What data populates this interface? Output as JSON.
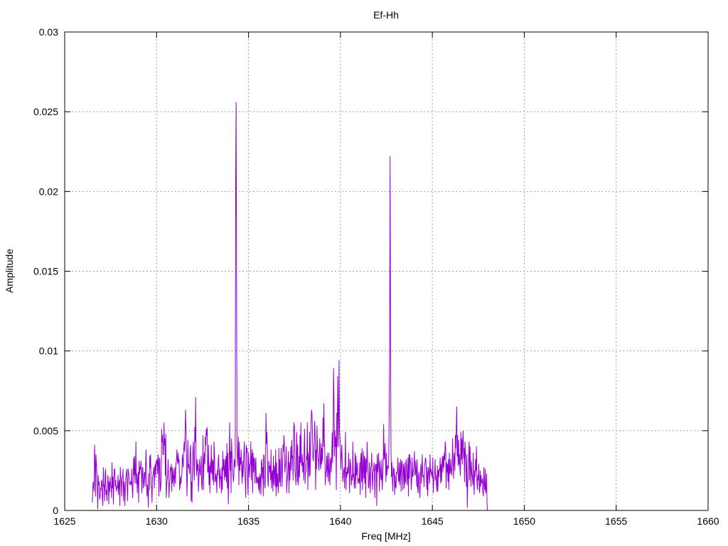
{
  "chart_data": {
    "type": "line",
    "title": "Ef-Hh",
    "xlabel": "Freq [MHz]",
    "ylabel": "Amplitude",
    "xlim": [
      1625,
      1660
    ],
    "ylim": [
      0,
      0.03
    ],
    "x_ticks": [
      "1625",
      "1630",
      "1635",
      "1640",
      "1645",
      "1650",
      "1655",
      "1660"
    ],
    "y_ticks": [
      "0",
      "0.005",
      "0.01",
      "0.015",
      "0.02",
      "0.025",
      "0.03"
    ],
    "grid": true,
    "legend": "none",
    "series": [
      {
        "color": "#9400d3",
        "x_start": 1626.5,
        "x_step": 0.025,
        "values": [
          0.0005,
          0.0012,
          0.0018,
          0.0015,
          0.0012,
          0.0041,
          0.0032,
          0.0009,
          0.0035,
          0.003,
          0.0023,
          0.0012,
          0.0001,
          0.0022,
          0.0016,
          0.0018,
          0.0007,
          0.0008,
          0.0014,
          0.0013,
          0.0019,
          0.0018,
          0.0007,
          0.0003,
          0.0027,
          0.0015,
          0.0016,
          0.0006,
          0.0023,
          0.0026,
          0.001,
          0.0013,
          0.0006,
          0.0013,
          0.0022,
          0.0017,
          0.0004,
          0.0018,
          0.0012,
          0.0021,
          0.0015,
          0.0015,
          0.0008,
          0.003,
          0.0014,
          0.0021,
          0.0004,
          0.0019,
          0.0026,
          0.0026,
          0.0015,
          0.0019,
          0.0014,
          0.0012,
          0.0015,
          0.0014,
          0.0022,
          0.001,
          0.0017,
          0.0019,
          0.0003,
          0.0027,
          0.0021,
          0.0018,
          0.0009,
          0.0021,
          0.0021,
          0.0026,
          0.0006,
          0.0018,
          0.0016,
          0.0003,
          0.0015,
          0.0021,
          0.0023,
          0.0026,
          0.0014,
          0.0006,
          0.0026,
          0.0024,
          0.0022,
          0.0017,
          0.0016,
          0.0018,
          0.0018,
          0.0016,
          0.0026,
          0.0013,
          0.0008,
          0.0021,
          0.0033,
          0.0022,
          0.0034,
          0.0017,
          0.0024,
          0.0043,
          0.0017,
          0.0023,
          0.0011,
          0.0019,
          0.0024,
          0.0005,
          0.0031,
          0.0023,
          0.0027,
          0.0026,
          0.0031,
          0.0024,
          0.0011,
          0.0026,
          0.0027,
          0.0014,
          0.0017,
          0.0023,
          0.0024,
          0.0015,
          0.0029,
          0.0038,
          0.0022,
          0.0009,
          0.0016,
          0.0011,
          0.0002,
          0.0023,
          0.0013,
          0.0034,
          0.0027,
          0.0035,
          0.0015,
          0.0015,
          0.0005,
          0.002,
          0.0023,
          0.0024,
          0.0027,
          0.0014,
          0.0027,
          0.0029,
          0.0021,
          0.0031,
          0.0029,
          0.0032,
          0.0023,
          0.0035,
          0.0031,
          0.0009,
          0.0033,
          0.0032,
          0.0012,
          0.0014,
          0.002,
          0.0051,
          0.0043,
          0.0047,
          0.0035,
          0.0035,
          0.0055,
          0.0041,
          0.0045,
          0.0022,
          0.0048,
          0.0008,
          0.0016,
          0.0019,
          0.0022,
          0.0032,
          0.0021,
          0.0008,
          0.0016,
          0.0019,
          0.0027,
          0.0025,
          0.0029,
          0.0012,
          0.0027,
          0.0017,
          0.0021,
          0.0026,
          0.0015,
          0.0021,
          0.0027,
          0.0017,
          0.0029,
          0.0031,
          0.0038,
          0.0032,
          0.0029,
          0.0036,
          0.003,
          0.0032,
          0.0013,
          0.0015,
          0.0021,
          0.0017,
          0.0021,
          0.0023,
          0.0035,
          0.0031,
          0.0027,
          0.0038,
          0.0043,
          0.0037,
          0.0049,
          0.0063,
          0.0051,
          0.0033,
          0.0009,
          0.0021,
          0.0044,
          0.0027,
          0.0029,
          0.0025,
          0.0023,
          0.0038,
          0.0041,
          0.0006,
          0.0018,
          0.0005,
          0.003,
          0.0038,
          0.0043,
          0.0024,
          0.0019,
          0.0052,
          0.0043,
          0.0071,
          0.003,
          0.0022,
          0.0032,
          0.0025,
          0.0029,
          0.0012,
          0.0019,
          0.0032,
          0.0025,
          0.0022,
          0.0028,
          0.0034,
          0.0016,
          0.0013,
          0.0026,
          0.0047,
          0.0013,
          0.0031,
          0.0036,
          0.0029,
          0.0046,
          0.0041,
          0.0051,
          0.0047,
          0.0052,
          0.0024,
          0.0024,
          0.0041,
          0.0016,
          0.0028,
          0.0011,
          0.003,
          0.0024,
          0.0041,
          0.0023,
          0.0032,
          0.0019,
          0.0031,
          0.0016,
          0.0043,
          0.0036,
          0.0018,
          0.0018,
          0.0023,
          0.0021,
          0.0011,
          0.0025,
          0.0022,
          0.0031,
          0.0035,
          0.0022,
          0.0014,
          0.0026,
          0.002,
          0.0021,
          0.0011,
          0.0027,
          0.0013,
          0.0037,
          0.0025,
          0.0032,
          0.0026,
          0.0019,
          0.0032,
          0.0021,
          0.0034,
          0.0018,
          0.0042,
          0.0014,
          0.0036,
          0.0004,
          0.0017,
          0.0035,
          0.0055,
          0.0025,
          0.0037,
          0.0011,
          0.0045,
          0.0036,
          0.0031,
          0.0024,
          0.0018,
          0.0021,
          0.0032,
          0.0029,
          0.0027,
          0.0205,
          0.0256,
          0.0145,
          0.0042,
          0.0028,
          0.0035,
          0.0046,
          0.0016,
          0.0043,
          0.0025,
          0.0033,
          0.0029,
          0.0038,
          0.0026,
          0.0017,
          0.0031,
          0.0021,
          0.0028,
          0.0037,
          0.0043,
          0.0024,
          0.0018,
          0.0008,
          0.0041,
          0.0036,
          0.0039,
          0.0019,
          0.001,
          0.0036,
          0.0028,
          0.0021,
          0.0029,
          0.0029,
          0.0043,
          0.0019,
          0.0033,
          0.0038,
          0.0011,
          0.0036,
          0.0024,
          0.0033,
          0.0032,
          0.0017,
          0.0028,
          0.0033,
          0.0017,
          0.0021,
          0.0019,
          0.0017,
          0.0021,
          0.0013,
          0.0021,
          0.0011,
          0.0023,
          0.0021,
          0.001,
          0.003,
          0.0032,
          0.002,
          0.0027,
          0.0009,
          0.0035,
          0.0034,
          0.0016,
          0.0014,
          0.0026,
          0.0061,
          0.0042,
          0.0049,
          0.0038,
          0.0019,
          0.0015,
          0.0031,
          0.0028,
          0.0024,
          0.0028,
          0.0019,
          0.0038,
          0.0014,
          0.0022,
          0.0025,
          0.0012,
          0.0034,
          0.0016,
          0.0028,
          0.0025,
          0.0015,
          0.0038,
          0.0009,
          0.003,
          0.0015,
          0.0023,
          0.0015,
          0.0011,
          0.0039,
          0.0018,
          0.0032,
          0.0015,
          0.002,
          0.0039,
          0.0028,
          0.0015,
          0.0027,
          0.0041,
          0.0037,
          0.0047,
          0.0042,
          0.0024,
          0.0029,
          0.0029,
          0.004,
          0.0011,
          0.0018,
          0.0021,
          0.0029,
          0.0037,
          0.0011,
          0.003,
          0.0019,
          0.0029,
          0.004,
          0.0025,
          0.0044,
          0.0033,
          0.0034,
          0.0019,
          0.0048,
          0.0055,
          0.0052,
          0.0024,
          0.0022,
          0.0016,
          0.0038,
          0.0049,
          0.0018,
          0.0041,
          0.0016,
          0.002,
          0.0034,
          0.0021,
          0.0047,
          0.003,
          0.0055,
          0.003,
          0.0028,
          0.0035,
          0.0024,
          0.003,
          0.0019,
          0.0039,
          0.0051,
          0.0017,
          0.0024,
          0.0025,
          0.0034,
          0.0032,
          0.0055,
          0.0013,
          0.0036,
          0.0031,
          0.0021,
          0.0049,
          0.0022,
          0.0041,
          0.0053,
          0.0063,
          0.0061,
          0.0052,
          0.0033,
          0.0031,
          0.0037,
          0.0044,
          0.0056,
          0.0047,
          0.0013,
          0.0038,
          0.0026,
          0.0053,
          0.0039,
          0.0034,
          0.0031,
          0.0025,
          0.0038,
          0.0045,
          0.0029,
          0.0026,
          0.0042,
          0.0029,
          0.0039,
          0.0031,
          0.0058,
          0.004,
          0.0067,
          0.0045,
          0.0037,
          0.0016,
          0.0023,
          0.0025,
          0.0034,
          0.0021,
          0.0036,
          0.0026,
          0.0018,
          0.0036,
          0.0024,
          0.0016,
          0.0031,
          0.0033,
          0.0024,
          0.0033,
          0.0049,
          0.003,
          0.0045,
          0.0089,
          0.0069,
          0.0034,
          0.005,
          0.004,
          0.0046,
          0.0013,
          0.0061,
          0.004,
          0.0084,
          0.0062,
          0.004,
          0.0094,
          0.005,
          0.0045,
          0.0039,
          0.0026,
          0.0035,
          0.0041,
          0.0029,
          0.0018,
          0.0021,
          0.0025,
          0.0027,
          0.0014,
          0.0029,
          0.0049,
          0.0013,
          0.0024,
          0.0021,
          0.0027,
          0.0023,
          0.0024,
          0.0036,
          0.0024,
          0.0011,
          0.0032,
          0.0029,
          0.0023,
          0.0016,
          0.0022,
          0.0019,
          0.0043,
          0.0021,
          0.0023,
          0.0014,
          0.0018,
          0.0036,
          0.0014,
          0.0034,
          0.0022,
          0.0025,
          0.003,
          0.0017,
          0.002,
          0.0019,
          0.0017,
          0.003,
          0.001,
          0.0032,
          0.0036,
          0.0018,
          0.0039,
          0.0013,
          0.0025,
          0.0037,
          0.002,
          0.0034,
          0.0017,
          0.0033,
          0.0008,
          0.0032,
          0.0024,
          0.0043,
          0.0032,
          0.0024,
          0.0014,
          0.0015,
          0.003,
          0.0021,
          0.0011,
          0.0027,
          0.0028,
          0.0036,
          0.0023,
          0.0013,
          0.0024,
          0.0025,
          0.003,
          0.0023,
          0.0008,
          0.0029,
          0.0025,
          0.0029,
          0.0003,
          0.0035,
          0.0024,
          0.0027,
          0.0036,
          0.0026,
          0.0012,
          0.0031,
          0.0027,
          0.002,
          0.0019,
          0.0032,
          0.0013,
          0.0021,
          0.0028,
          0.0054,
          0.0032,
          0.0033,
          0.0042,
          0.0032,
          0.0018,
          0.0036,
          0.0022,
          0.0027,
          0.0028,
          0.0026,
          0.0033,
          0.0057,
          0.0097,
          0.0222,
          0.012,
          0.0039,
          0.0021,
          0.003,
          0.0019,
          0.0012,
          0.0027,
          0.0022,
          0.0026,
          0.001,
          0.0022,
          0.0015,
          0.0014,
          0.0024,
          0.0023,
          0.0025,
          0.0033,
          0.0019,
          0.0018,
          0.003,
          0.0016,
          0.0024,
          0.0032,
          0.0012,
          0.003,
          0.0031,
          0.0024,
          0.0013,
          0.0029,
          0.0026,
          0.0014,
          0.003,
          0.0017,
          0.0019,
          0.0032,
          0.0028,
          0.0016,
          0.0021,
          0.0033,
          0.0009,
          0.0035,
          0.002,
          0.0035,
          0.0031,
          0.0029,
          0.0013,
          0.0018,
          0.0033,
          0.0021,
          0.0022,
          0.0026,
          0.0029,
          0.0037,
          0.0022,
          0.0023,
          0.0031,
          0.0025,
          0.0015,
          0.0032,
          0.0014,
          0.0011,
          0.0022,
          0.0024,
          0.0013,
          0.0008,
          0.0021,
          0.0029,
          0.0017,
          0.0025,
          0.0035,
          0.0022,
          0.0021,
          0.0022,
          0.0015,
          0.0028,
          0.003,
          0.0033,
          0.0032,
          0.0022,
          0.0013,
          0.0027,
          0.0009,
          0.0024,
          0.0027,
          0.0021,
          0.0017,
          0.0035,
          0.0024,
          0.0026,
          0.0022,
          0.0024,
          0.002,
          0.0033,
          0.0011,
          0.0018,
          0.0021,
          0.0023,
          0.0032,
          0.0019,
          0.0022,
          0.0016,
          0.0012,
          0.0028,
          0.0012,
          0.0025,
          0.0021,
          0.0026,
          0.0025,
          0.0033,
          0.0017,
          0.0029,
          0.0018,
          0.003,
          0.0034,
          0.0024,
          0.0034,
          0.0027,
          0.0036,
          0.0032,
          0.0043,
          0.004,
          0.0014,
          0.003,
          0.0024,
          0.0029,
          0.0018,
          0.0032,
          0.0013,
          0.0036,
          0.0023,
          0.0024,
          0.0032,
          0.0025,
          0.0022,
          0.0029,
          0.0045,
          0.0031,
          0.002,
          0.0033,
          0.0036,
          0.0025,
          0.0047,
          0.0039,
          0.0051,
          0.0065,
          0.0034,
          0.0047,
          0.0028,
          0.0044,
          0.0029,
          0.0035,
          0.0026,
          0.0022,
          0.0049,
          0.0032,
          0.0045,
          0.0029,
          0.0044,
          0.005,
          0.0033,
          0.0039,
          0.0018,
          0.0043,
          0.0036,
          0.0028,
          0.0015,
          0.0035,
          0.0002,
          0.0016,
          0.0022,
          0.0033,
          0.0043,
          0.0019,
          0.004,
          0.0026,
          0.0015,
          0.0031,
          0.0023,
          0.0021,
          0.0016,
          0.0036,
          0.0018,
          0.001,
          0.0025,
          0.0021,
          0.0032,
          0.0025,
          0.004,
          0.0017,
          0.0013,
          0.0022,
          0.0019,
          0.0029,
          0.0013,
          0.0011,
          0.0025,
          0.0015,
          0.0022,
          0.0018,
          0.0017,
          0.002,
          0.0011,
          0.0009,
          0.0027,
          0.0016,
          0.0013,
          0.0026,
          0.0011,
          0.0012,
          0.0023,
          0.0005,
          0.0
        ]
      }
    ]
  }
}
